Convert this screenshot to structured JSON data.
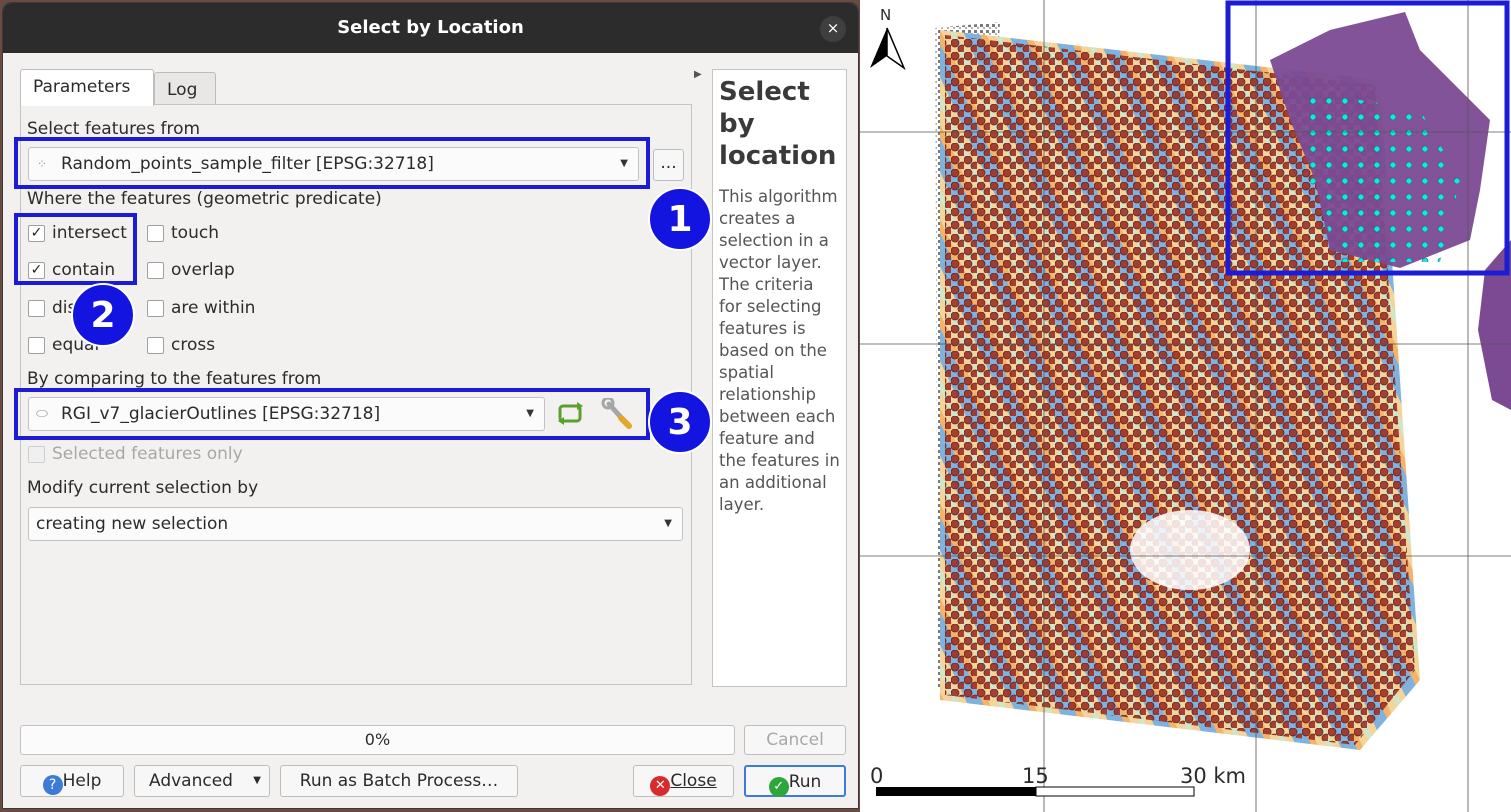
{
  "dialog": {
    "title": "Select by Location",
    "close_glyph": "×",
    "tabs": [
      "Parameters",
      "Log"
    ],
    "select_from_label": "Select features from",
    "select_from_value": "Random_points_sample_filter [EPSG:32718]",
    "more_button": "...",
    "predicate_label": "Where the features (geometric predicate)",
    "predicates": [
      {
        "label": "intersect",
        "checked": true
      },
      {
        "label": "touch",
        "checked": false
      },
      {
        "label": "contain",
        "checked": true
      },
      {
        "label": "overlap",
        "checked": false
      },
      {
        "label": "disjoint",
        "checked": false
      },
      {
        "label": "are within",
        "checked": false
      },
      {
        "label": "equal",
        "checked": false
      },
      {
        "label": "cross",
        "checked": false
      }
    ],
    "compare_label": "By comparing to the features from",
    "compare_value": "RGI_v7_glacierOutlines [EPSG:32718]",
    "selected_only_label": "Selected features only",
    "modify_label": "Modify current selection by",
    "modify_value": "creating new selection",
    "progress": "0%",
    "progress_fraction": 0,
    "buttons": {
      "cancel": "Cancel",
      "help": "Help",
      "advanced": "Advanced",
      "batch": "Run as Batch Process…",
      "close": "Close",
      "run": "Run"
    },
    "help_pane": {
      "title": "Select by location",
      "text": "This algorithm creates a selection in a vector layer. The criteria for selecting features is based on the spatial relationship between each feature and the features in an additional layer."
    }
  },
  "annotations": {
    "badge_1": "1",
    "badge_2": "2",
    "badge_3": "3",
    "highlight_color": "#1c1cd6"
  },
  "map": {
    "north_label": "N",
    "scale_labels": [
      "0",
      "15",
      "30 km"
    ],
    "colors": {
      "points": "#a03228",
      "selected_points": "#20e0e0",
      "glacier": "#7b4a93",
      "raster_blue": "#4e8fce",
      "raster_orange": "#f3b46a"
    }
  }
}
